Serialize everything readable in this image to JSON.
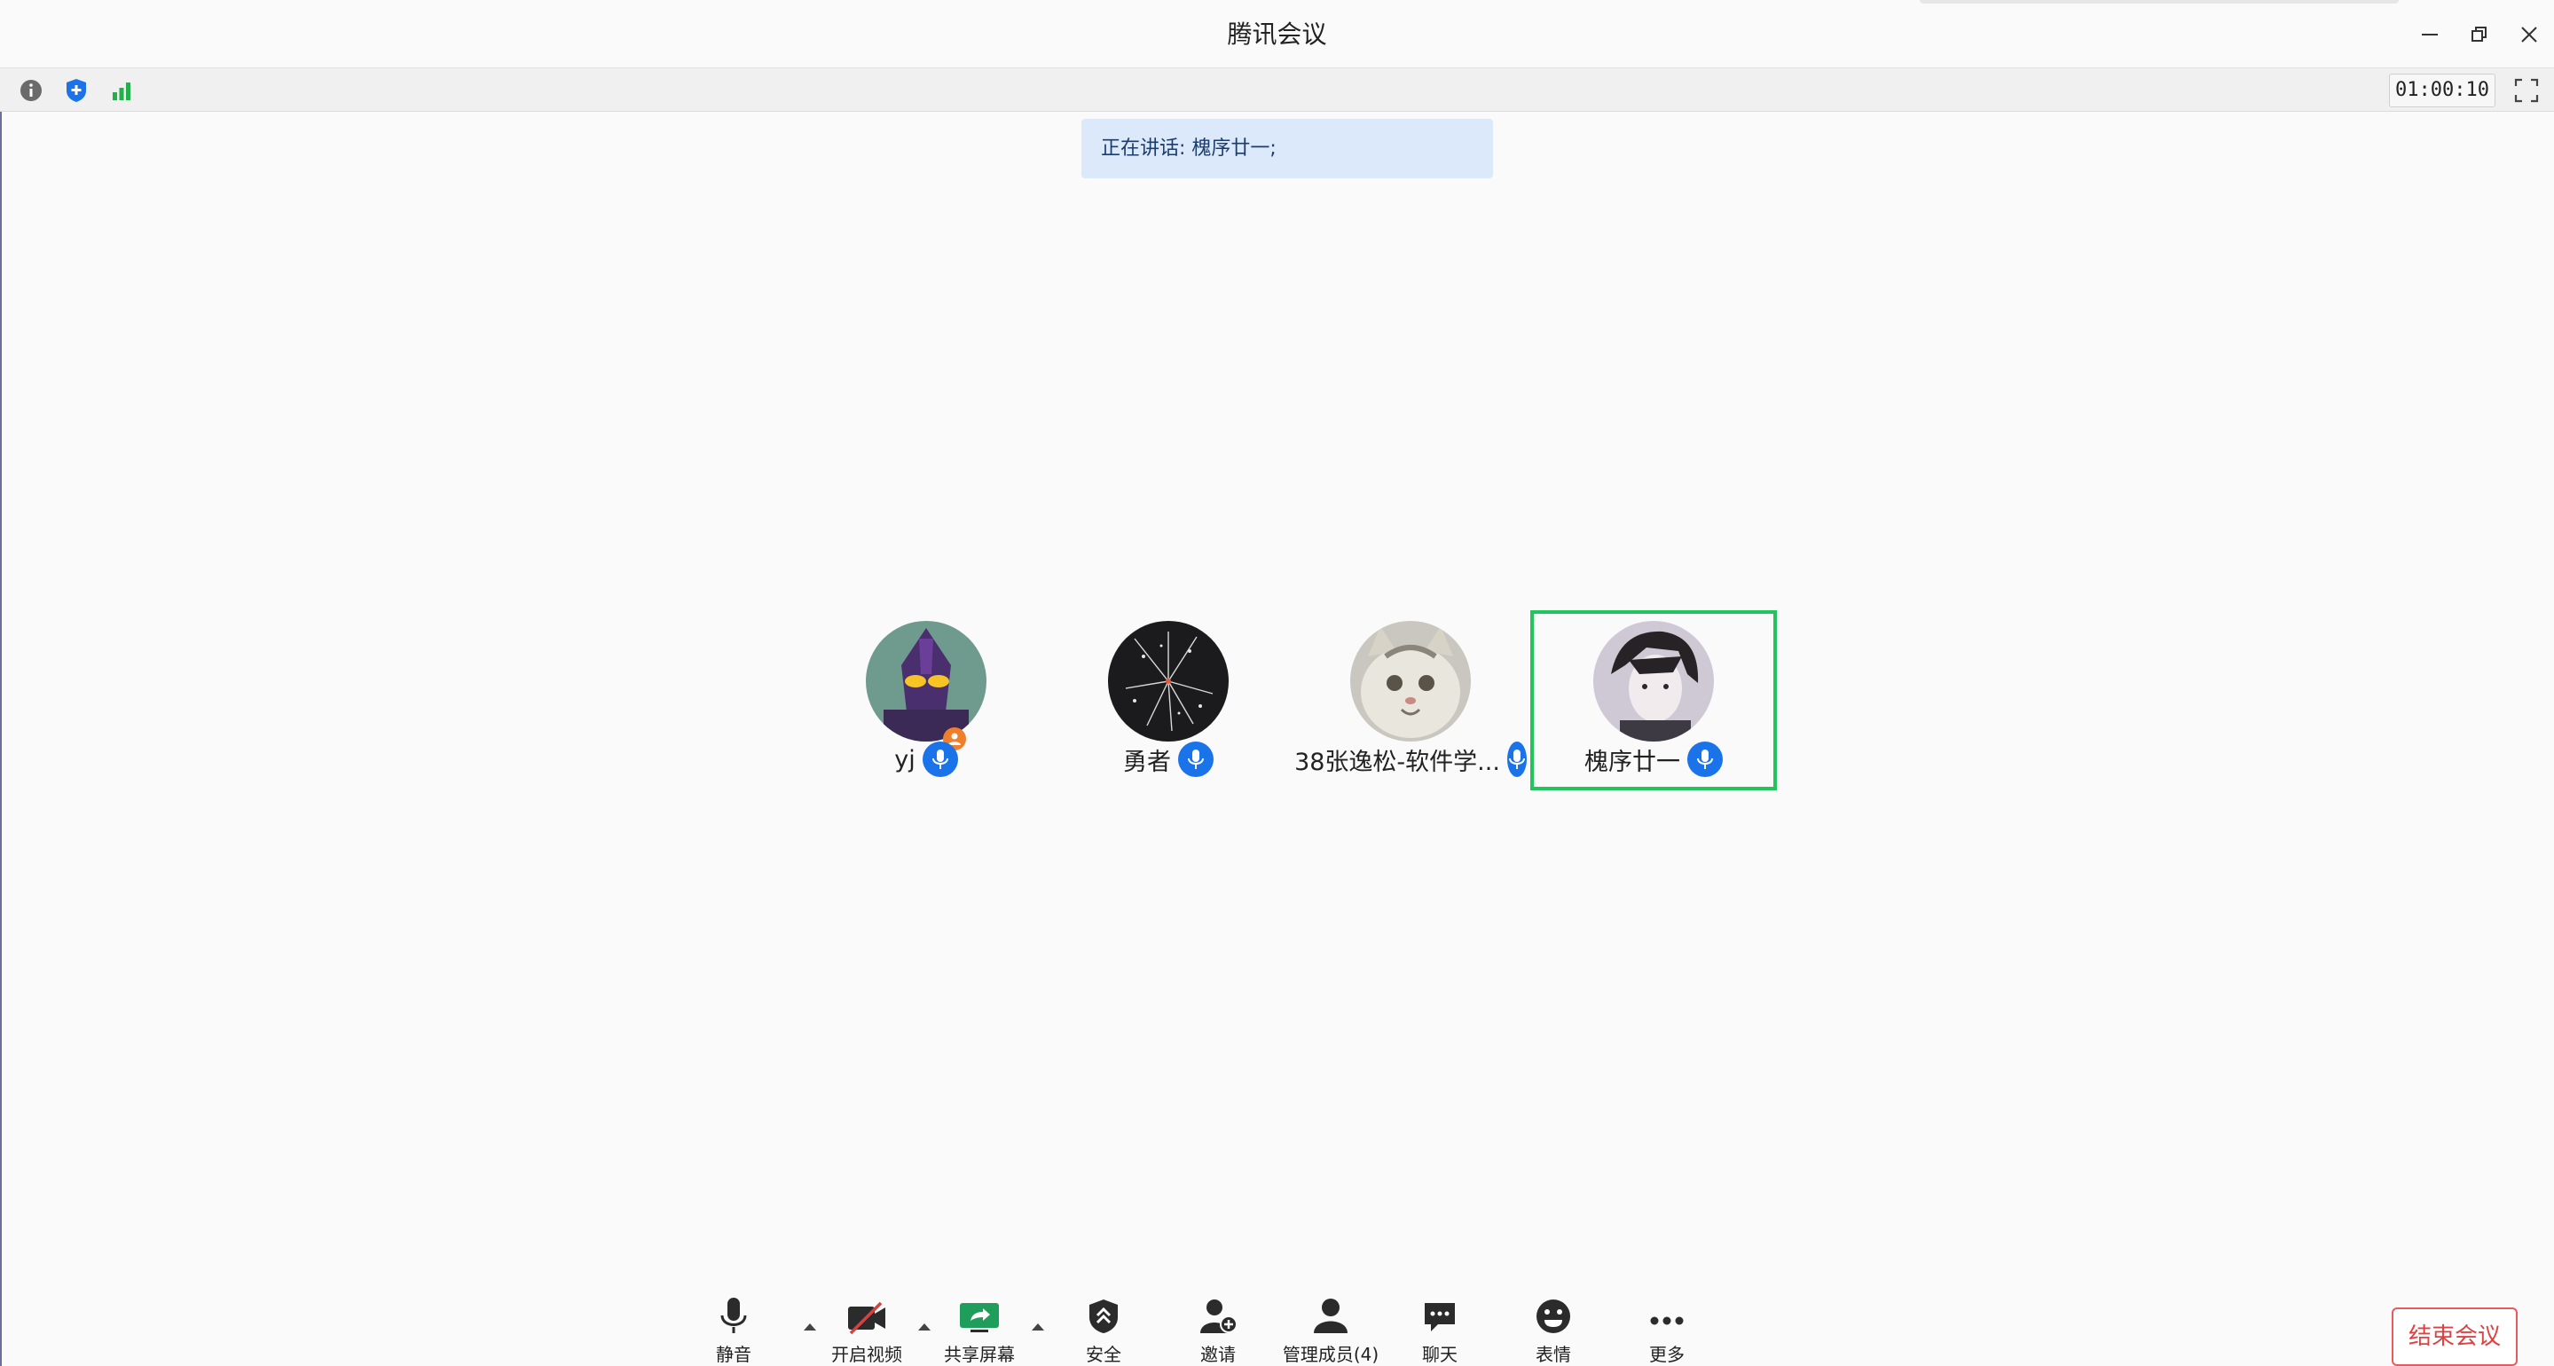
{
  "window": {
    "title": "腾讯会议"
  },
  "toolbar": {
    "timer": "01:00:10",
    "icons": [
      "info-icon",
      "security-shield-icon",
      "signal-strength-icon",
      "fullscreen-icon"
    ]
  },
  "speaking_banner": {
    "text": "正在讲话: 槐序廿一;"
  },
  "participants": [
    {
      "name": "yj",
      "is_host": true,
      "mic": "on"
    },
    {
      "name": "勇者",
      "is_host": false,
      "mic": "on"
    },
    {
      "name": "38张逸松-软件学...",
      "is_host": false,
      "mic": "on"
    },
    {
      "name": "槐序廿一",
      "is_host": false,
      "mic": "on",
      "speaking": true
    }
  ],
  "bottom_bar": {
    "mute": "静音",
    "video": "开启视频",
    "share": "共享屏幕",
    "security": "安全",
    "invite": "邀请",
    "manage": "管理成员(4)",
    "chat": "聊天",
    "reactions": "表情",
    "more": "更多",
    "end": "结束会议"
  },
  "colors": {
    "accent_blue": "#1a73e8",
    "speaking_green": "#22c45c",
    "end_red": "#e04040",
    "banner_bg": "#dce9fb"
  }
}
